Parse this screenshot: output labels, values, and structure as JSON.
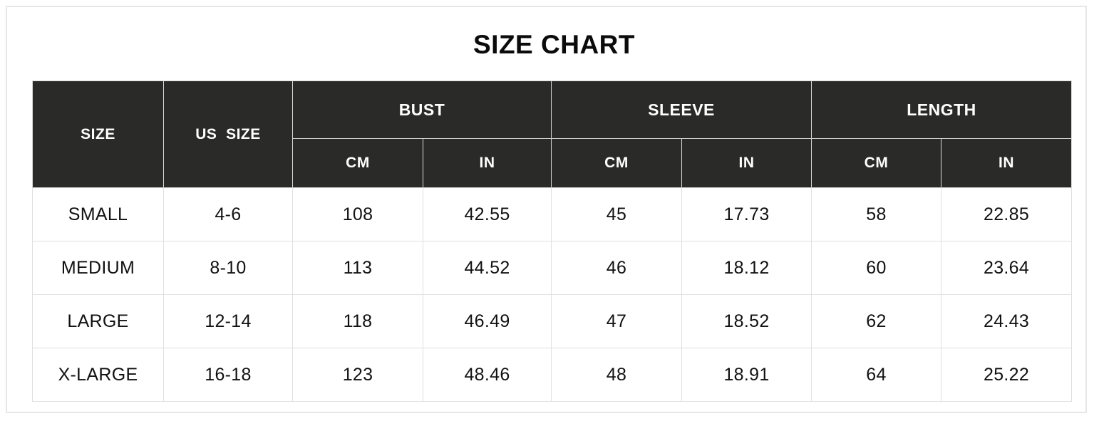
{
  "title": "SIZE CHART",
  "table": {
    "header": {
      "size_label": "SIZE",
      "us_size_label": "US  SIZE",
      "groups": [
        {
          "label": "BUST",
          "units": [
            "CM",
            "IN"
          ]
        },
        {
          "label": "SLEEVE",
          "units": [
            "CM",
            "IN"
          ]
        },
        {
          "label": "LENGTH",
          "units": [
            "CM",
            "IN"
          ]
        }
      ]
    },
    "rows": [
      {
        "size": "SMALL",
        "us_size": "4-6",
        "bust_cm": "108",
        "bust_in": "42.55",
        "sleeve_cm": "45",
        "sleeve_in": "17.73",
        "length_cm": "58",
        "length_in": "22.85"
      },
      {
        "size": "MEDIUM",
        "us_size": "8-10",
        "bust_cm": "113",
        "bust_in": "44.52",
        "sleeve_cm": "46",
        "sleeve_in": "18.12",
        "length_cm": "60",
        "length_in": "23.64"
      },
      {
        "size": "LARGE",
        "us_size": "12-14",
        "bust_cm": "118",
        "bust_in": "46.49",
        "sleeve_cm": "47",
        "sleeve_in": "18.52",
        "length_cm": "62",
        "length_in": "24.43"
      },
      {
        "size": "X-LARGE",
        "us_size": "16-18",
        "bust_cm": "123",
        "bust_in": "48.46",
        "sleeve_cm": "48",
        "sleeve_in": "18.91",
        "length_cm": "64",
        "length_in": "25.22"
      }
    ]
  },
  "colors": {
    "header_background": "#2a2a28",
    "header_text": "#ffffff",
    "body_text": "#111111",
    "grid_line": "#e0e0e0",
    "page_border": "#e7e7e7",
    "page_background": "#ffffff"
  }
}
